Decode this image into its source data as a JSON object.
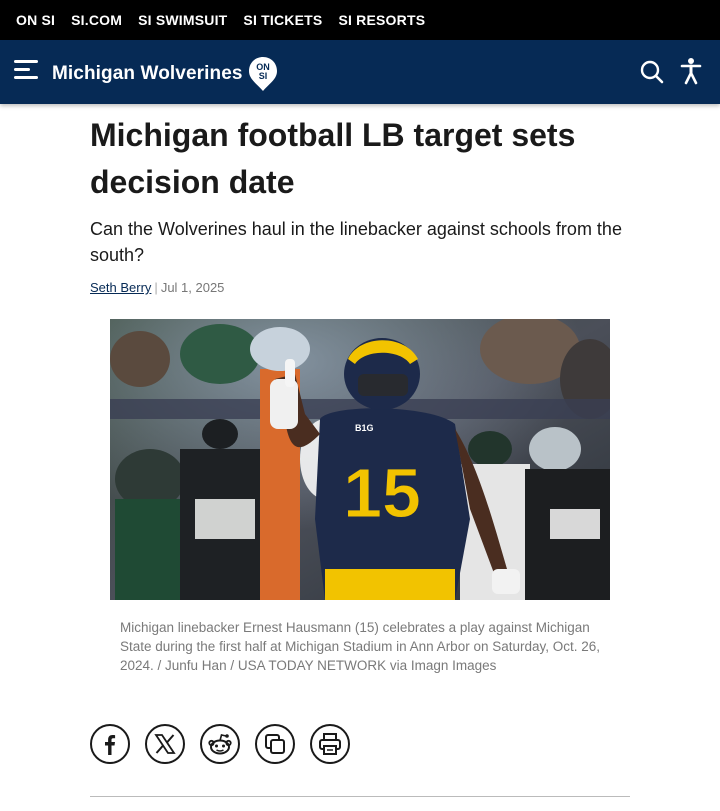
{
  "topnav": {
    "links": [
      "ON SI",
      "SI.COM",
      "SI SWIMSUIT",
      "SI TICKETS",
      "SI RESORTS"
    ]
  },
  "header": {
    "site_name": "Michigan Wolverines",
    "badge_text_top": "ON",
    "badge_text_bottom": "SI",
    "menu_icon": "hamburger-menu-icon",
    "search_icon": "search-icon",
    "accessibility_icon": "accessibility-icon"
  },
  "article": {
    "title": "Michigan football LB target sets decision date",
    "subtitle": "Can the Wolverines haul in the linebacker against schools from the south?",
    "author": "Seth Berry",
    "separator": "|",
    "date": "Jul 1, 2025",
    "image": {
      "jersey_number": "15",
      "helmet_logo": "B1G"
    },
    "caption": "Michigan linebacker Ernest Hausmann (15) celebrates a play against Michigan State during the first half at Michigan Stadium in Ann Arbor on Saturday, Oct. 26, 2024. / Junfu Han / USA TODAY NETWORK via Imagn Images"
  },
  "share": {
    "icons": [
      "facebook-icon",
      "x-icon",
      "reddit-icon",
      "copy-link-icon",
      "print-icon"
    ]
  },
  "colors": {
    "topbar": "#000000",
    "navbar": "#062a55",
    "maize": "#f2c300",
    "text": "#1a1a1a",
    "caption": "#7a7a7a"
  }
}
